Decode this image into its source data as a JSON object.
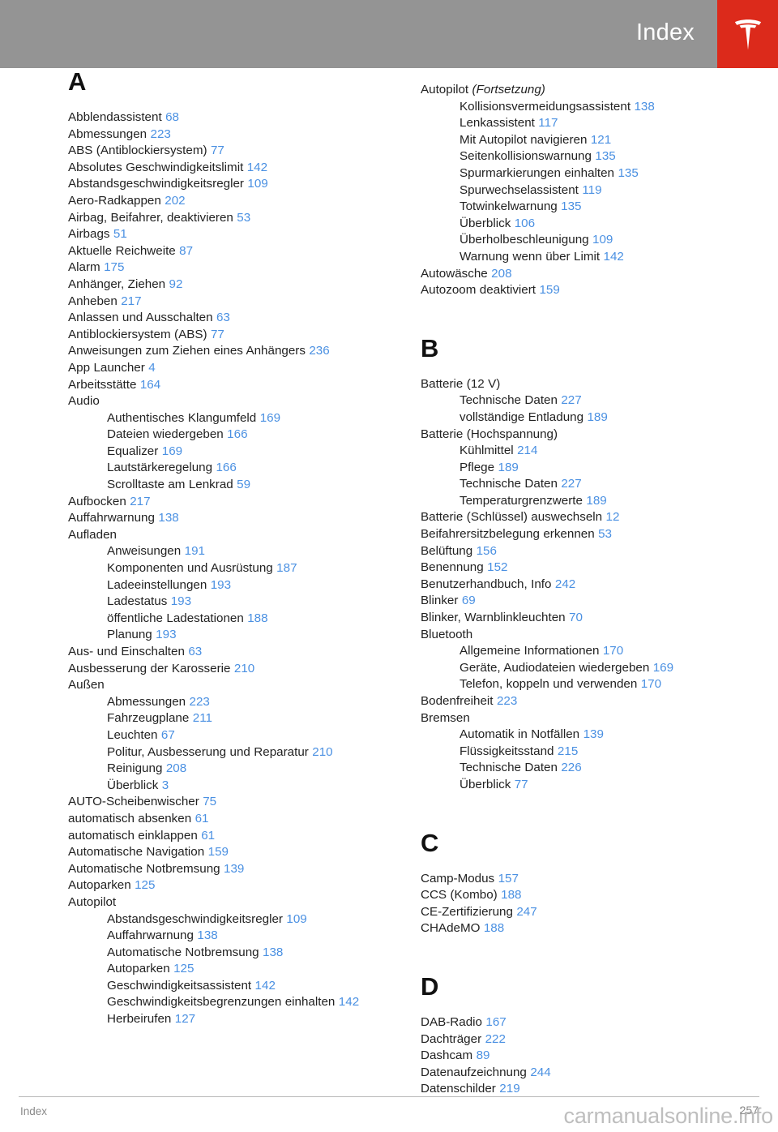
{
  "header": {
    "title": "Index",
    "logo_icon": "tesla-logo-icon",
    "grey_color": "#949494",
    "red_color": "#dc2a1b"
  },
  "footer": {
    "left_label": "Index",
    "page_number": "257",
    "watermark": "carmanualsonline.info"
  },
  "colors": {
    "page_link": "#4a90e2",
    "text": "#222222"
  },
  "columns": [
    {
      "id": "left",
      "sections": [
        {
          "letter": "A",
          "entries": [
            {
              "level": 1,
              "text": "Abblendassistent",
              "page": "68"
            },
            {
              "level": 1,
              "text": "Abmessungen",
              "page": "223"
            },
            {
              "level": 1,
              "text": "ABS (Antiblockiersystem)",
              "page": "77"
            },
            {
              "level": 1,
              "text": "Absolutes Geschwindigkeitslimit",
              "page": "142"
            },
            {
              "level": 1,
              "text": "Abstandsgeschwindigkeitsregler",
              "page": "109"
            },
            {
              "level": 1,
              "text": "Aero-Radkappen",
              "page": "202"
            },
            {
              "level": 1,
              "text": "Airbag, Beifahrer, deaktivieren",
              "page": "53"
            },
            {
              "level": 1,
              "text": "Airbags",
              "page": "51"
            },
            {
              "level": 1,
              "text": "Aktuelle Reichweite",
              "page": "87"
            },
            {
              "level": 1,
              "text": "Alarm",
              "page": "175"
            },
            {
              "level": 1,
              "text": "Anhänger, Ziehen",
              "page": "92"
            },
            {
              "level": 1,
              "text": "Anheben",
              "page": "217"
            },
            {
              "level": 1,
              "text": "Anlassen und Ausschalten",
              "page": "63"
            },
            {
              "level": 1,
              "text": "Antiblockiersystem (ABS)",
              "page": "77"
            },
            {
              "level": 1,
              "text": "Anweisungen zum Ziehen eines Anhängers",
              "page": "236"
            },
            {
              "level": 1,
              "text": "App Launcher",
              "page": "4"
            },
            {
              "level": 1,
              "text": "Arbeitsstätte",
              "page": "164"
            },
            {
              "level": 1,
              "text": "Audio",
              "page": ""
            },
            {
              "level": 2,
              "text": "Authentisches Klangumfeld",
              "page": "169"
            },
            {
              "level": 2,
              "text": "Dateien wiedergeben",
              "page": "166"
            },
            {
              "level": 2,
              "text": "Equalizer",
              "page": "169"
            },
            {
              "level": 2,
              "text": "Lautstärkeregelung",
              "page": "166"
            },
            {
              "level": 2,
              "text": "Scrolltaste am Lenkrad",
              "page": "59"
            },
            {
              "level": 1,
              "text": "Aufbocken",
              "page": "217"
            },
            {
              "level": 1,
              "text": "Auffahrwarnung",
              "page": "138"
            },
            {
              "level": 1,
              "text": "Aufladen",
              "page": ""
            },
            {
              "level": 2,
              "text": "Anweisungen",
              "page": "191"
            },
            {
              "level": 2,
              "text": "Komponenten und Ausrüstung",
              "page": "187"
            },
            {
              "level": 2,
              "text": "Ladeeinstellungen",
              "page": "193"
            },
            {
              "level": 2,
              "text": "Ladestatus",
              "page": "193"
            },
            {
              "level": 2,
              "text": "öffentliche Ladestationen",
              "page": "188"
            },
            {
              "level": 2,
              "text": "Planung",
              "page": "193"
            },
            {
              "level": 1,
              "text": "Aus- und Einschalten",
              "page": "63"
            },
            {
              "level": 1,
              "text": "Ausbesserung der Karosserie",
              "page": "210"
            },
            {
              "level": 1,
              "text": "Außen",
              "page": ""
            },
            {
              "level": 2,
              "text": "Abmessungen",
              "page": "223"
            },
            {
              "level": 2,
              "text": "Fahrzeugplane",
              "page": "211"
            },
            {
              "level": 2,
              "text": "Leuchten",
              "page": "67"
            },
            {
              "level": 2,
              "text": "Politur, Ausbesserung und Reparatur",
              "page": "210"
            },
            {
              "level": 2,
              "text": "Reinigung",
              "page": "208"
            },
            {
              "level": 2,
              "text": "Überblick",
              "page": "3"
            },
            {
              "level": 1,
              "text": "AUTO-Scheibenwischer",
              "page": "75"
            },
            {
              "level": 1,
              "text": "automatisch absenken",
              "page": "61"
            },
            {
              "level": 1,
              "text": "automatisch einklappen",
              "page": "61"
            },
            {
              "level": 1,
              "text": "Automatische Navigation",
              "page": "159"
            },
            {
              "level": 1,
              "text": "Automatische Notbremsung",
              "page": "139"
            },
            {
              "level": 1,
              "text": "Autoparken",
              "page": "125"
            },
            {
              "level": 1,
              "text": "Autopilot",
              "page": ""
            },
            {
              "level": 2,
              "text": "Abstandsgeschwindigkeitsregler",
              "page": "109"
            },
            {
              "level": 2,
              "text": "Auffahrwarnung",
              "page": "138"
            },
            {
              "level": 2,
              "text": "Automatische Notbremsung",
              "page": "138"
            },
            {
              "level": 2,
              "text": "Autoparken",
              "page": "125"
            },
            {
              "level": 2,
              "text": "Geschwindigkeitsassistent",
              "page": "142"
            },
            {
              "level": 2,
              "text": "Geschwindigkeitsbegrenzungen einhalten",
              "page": "142"
            },
            {
              "level": 2,
              "text": "Herbeirufen",
              "page": "127"
            }
          ]
        }
      ]
    },
    {
      "id": "right",
      "sections": [
        {
          "letter": "",
          "entries": [
            {
              "level": 1,
              "text": "Autopilot",
              "cont": "(Fortsetzung)",
              "page": ""
            },
            {
              "level": 2,
              "text": "Kollisionsvermeidungsassistent",
              "page": "138"
            },
            {
              "level": 2,
              "text": "Lenkassistent",
              "page": "117"
            },
            {
              "level": 2,
              "text": "Mit Autopilot navigieren",
              "page": "121"
            },
            {
              "level": 2,
              "text": "Seitenkollisionswarnung",
              "page": "135"
            },
            {
              "level": 2,
              "text": "Spurmarkierungen einhalten",
              "page": "135"
            },
            {
              "level": 2,
              "text": "Spurwechselassistent",
              "page": "119"
            },
            {
              "level": 2,
              "text": "Totwinkelwarnung",
              "page": "135"
            },
            {
              "level": 2,
              "text": "Überblick",
              "page": "106"
            },
            {
              "level": 2,
              "text": "Überholbeschleunigung",
              "page": "109"
            },
            {
              "level": 2,
              "text": "Warnung wenn über Limit",
              "page": "142"
            },
            {
              "level": 1,
              "text": "Autowäsche",
              "page": "208"
            },
            {
              "level": 1,
              "text": "Autozoom deaktiviert",
              "page": "159"
            }
          ]
        },
        {
          "letter": "B",
          "entries": [
            {
              "level": 1,
              "text": "Batterie (12 V)",
              "page": ""
            },
            {
              "level": 2,
              "text": "Technische Daten",
              "page": "227"
            },
            {
              "level": 2,
              "text": "vollständige Entladung",
              "page": "189"
            },
            {
              "level": 1,
              "text": "Batterie (Hochspannung)",
              "page": ""
            },
            {
              "level": 2,
              "text": "Kühlmittel",
              "page": "214"
            },
            {
              "level": 2,
              "text": "Pflege",
              "page": "189"
            },
            {
              "level": 2,
              "text": "Technische Daten",
              "page": "227"
            },
            {
              "level": 2,
              "text": "Temperaturgrenzwerte",
              "page": "189"
            },
            {
              "level": 1,
              "text": "Batterie (Schlüssel) auswechseln",
              "page": "12"
            },
            {
              "level": 1,
              "text": "Beifahrersitzbelegung erkennen",
              "page": "53"
            },
            {
              "level": 1,
              "text": "Belüftung",
              "page": "156"
            },
            {
              "level": 1,
              "text": "Benennung",
              "page": "152"
            },
            {
              "level": 1,
              "text": "Benutzerhandbuch, Info",
              "page": "242"
            },
            {
              "level": 1,
              "text": "Blinker",
              "page": "69"
            },
            {
              "level": 1,
              "text": "Blinker, Warnblinkleuchten",
              "page": "70"
            },
            {
              "level": 1,
              "text": "Bluetooth",
              "page": ""
            },
            {
              "level": 2,
              "text": "Allgemeine Informationen",
              "page": "170"
            },
            {
              "level": 2,
              "text": "Geräte, Audiodateien wiedergeben",
              "page": "169"
            },
            {
              "level": 2,
              "text": "Telefon, koppeln und verwenden",
              "page": "170"
            },
            {
              "level": 1,
              "text": "Bodenfreiheit",
              "page": "223"
            },
            {
              "level": 1,
              "text": "Bremsen",
              "page": ""
            },
            {
              "level": 2,
              "text": "Automatik in Notfällen",
              "page": "139"
            },
            {
              "level": 2,
              "text": "Flüssigkeitsstand",
              "page": "215"
            },
            {
              "level": 2,
              "text": "Technische Daten",
              "page": "226"
            },
            {
              "level": 2,
              "text": "Überblick",
              "page": "77"
            }
          ]
        },
        {
          "letter": "C",
          "entries": [
            {
              "level": 1,
              "text": "Camp-Modus",
              "page": "157"
            },
            {
              "level": 1,
              "text": "CCS (Kombo)",
              "page": "188"
            },
            {
              "level": 1,
              "text": "CE-Zertifizierung",
              "page": "247"
            },
            {
              "level": 1,
              "text": "CHAdeMO",
              "page": "188"
            }
          ]
        },
        {
          "letter": "D",
          "entries": [
            {
              "level": 1,
              "text": "DAB-Radio",
              "page": "167"
            },
            {
              "level": 1,
              "text": "Dachträger",
              "page": "222"
            },
            {
              "level": 1,
              "text": "Dashcam",
              "page": "89"
            },
            {
              "level": 1,
              "text": "Datenaufzeichnung",
              "page": "244"
            },
            {
              "level": 1,
              "text": "Datenschilder",
              "page": "219"
            }
          ]
        }
      ]
    }
  ]
}
